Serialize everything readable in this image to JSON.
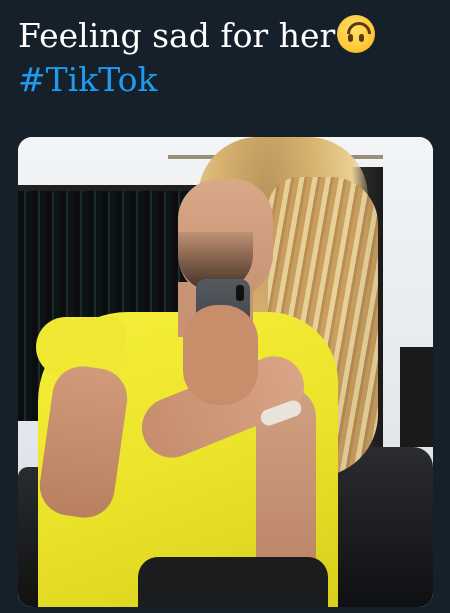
{
  "tweet": {
    "text": "Feeling sad for her",
    "emoji": "upside-down-face-emoji",
    "hashtag": "#TikTok"
  },
  "media": {
    "description_icon": "photo"
  },
  "colors": {
    "background": "#15202b",
    "text": "#ffffff",
    "hashtag": "#1d9bf0"
  }
}
